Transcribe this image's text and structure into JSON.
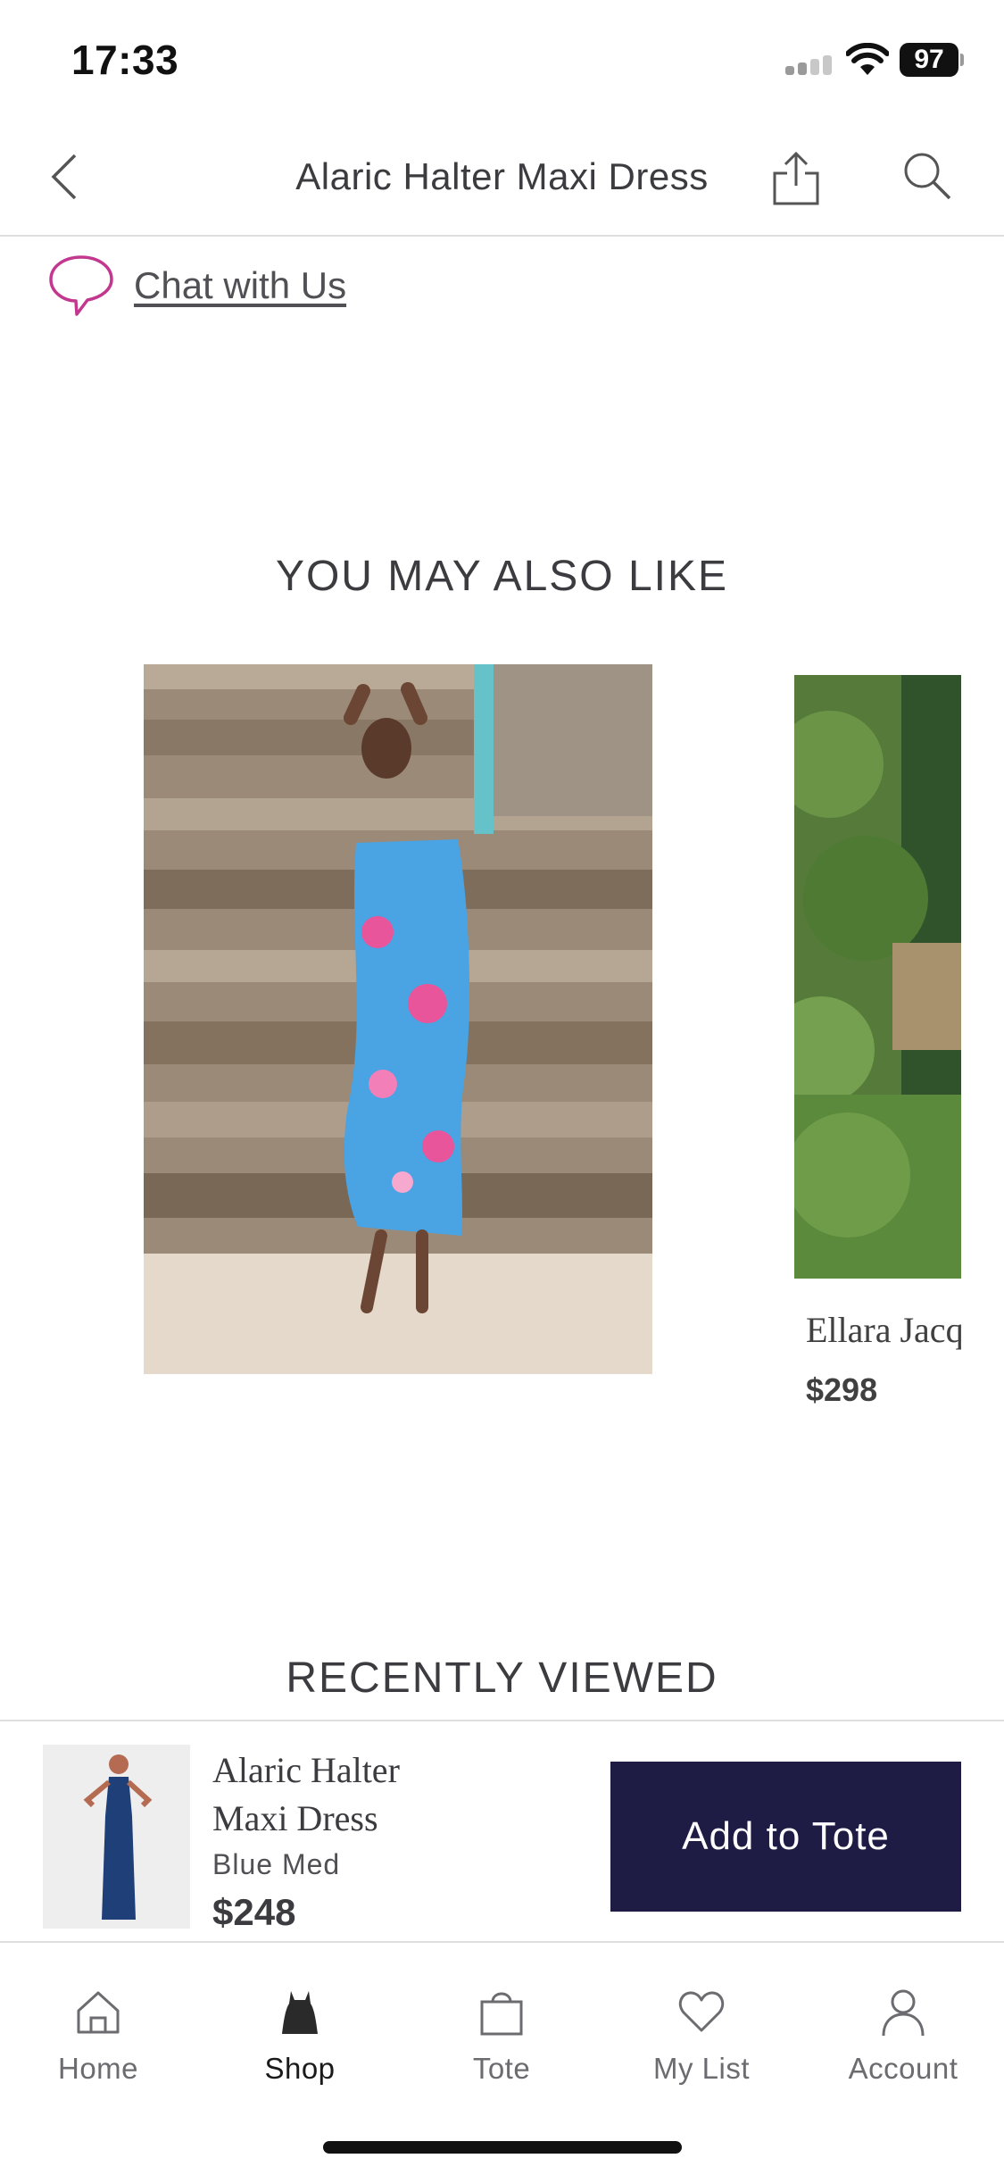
{
  "status_bar": {
    "time": "17:33",
    "battery": "97"
  },
  "header": {
    "title": "Alaric Halter Maxi Dress"
  },
  "chat": {
    "label": "Chat with Us"
  },
  "recommendations": {
    "title": "YOU MAY ALSO LIKE",
    "items": [
      {
        "name": "",
        "price": ""
      },
      {
        "name": "Ellara Jacq",
        "price": "$298"
      }
    ]
  },
  "recently_viewed": {
    "title": "RECENTLY VIEWED"
  },
  "sticky_bar": {
    "product_name": "Alaric Halter Maxi Dress",
    "color": "Blue Med",
    "price": "$248",
    "button_label": "Add to Tote"
  },
  "tab_bar": {
    "items": [
      {
        "label": "Home",
        "icon": "home-icon"
      },
      {
        "label": "Shop",
        "icon": "dress-icon"
      },
      {
        "label": "Tote",
        "icon": "bag-icon"
      },
      {
        "label": "My List",
        "icon": "heart-icon"
      },
      {
        "label": "Account",
        "icon": "person-icon"
      }
    ],
    "active": "Shop"
  },
  "colors": {
    "accent_pink": "#c2388f",
    "button_navy": "#1e1b44"
  }
}
